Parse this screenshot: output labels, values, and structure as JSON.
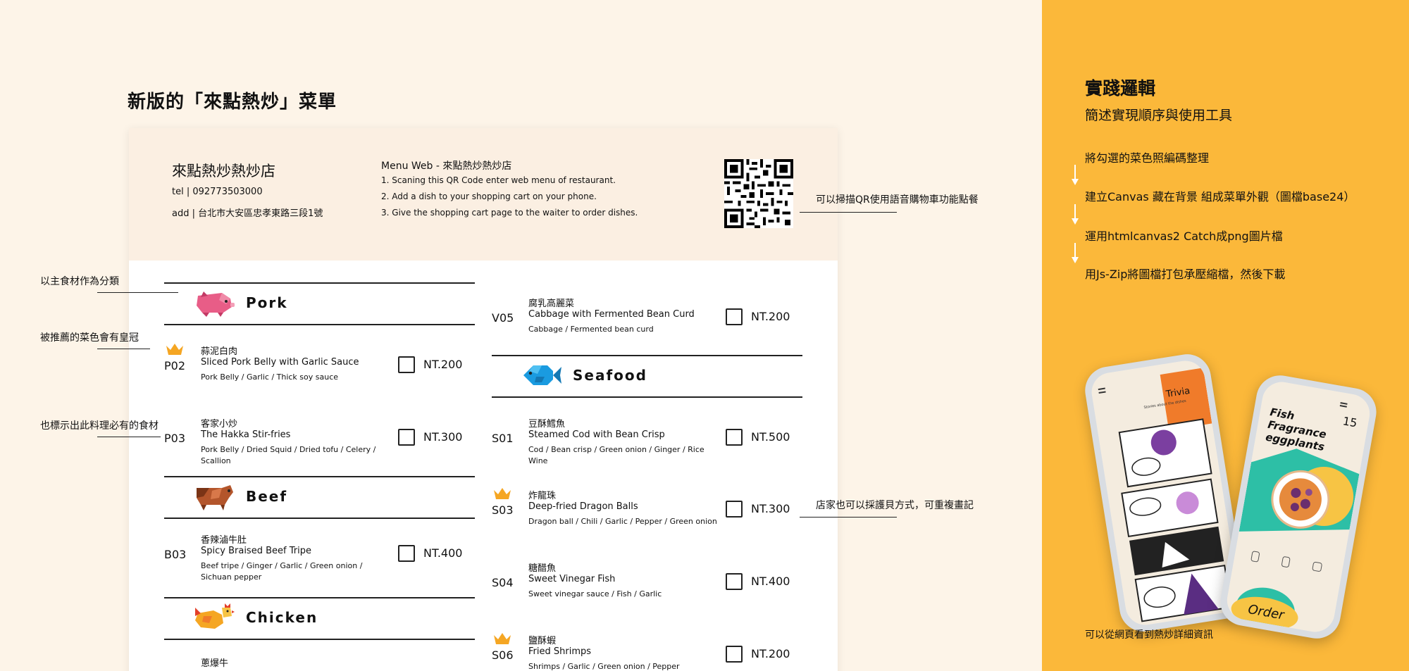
{
  "page_title": "新版的「來點熱炒」菜單",
  "header": {
    "shop_name": "來點熱炒熱炒店",
    "tel": "tel | 092773503000",
    "addr": "add | 台北市大安區忠孝東路三段1號",
    "web_title": "Menu Web - 來點熱炒熱炒店",
    "steps": [
      "1.  Scaning this QR Code enter web menu of restaurant.",
      "2.  Add a dish to your shopping cart on your phone.",
      "3.  Give the shopping cart page to the waiter to order dishes."
    ]
  },
  "categories": {
    "pork": "Pork",
    "beef": "Beef",
    "chicken": "Chicken",
    "seafood": "Seafood"
  },
  "items": {
    "p02": {
      "code": "P02",
      "zh": "蒜泥白肉",
      "en": "Sliced Pork Belly with Garlic Sauce",
      "ing": "Pork Belly / Garlic / Thick soy sauce",
      "price": "NT.200"
    },
    "p03": {
      "code": "P03",
      "zh": "客家小炒",
      "en": "The Hakka Stir-fries",
      "ing": "Pork Belly / Dried Squid / Dried tofu / Celery / Scallion",
      "price": "NT.300"
    },
    "b03": {
      "code": "B03",
      "zh": "香辣滷牛肚",
      "en": "Spicy Braised Beef Tripe",
      "ing": "Beef tripe / Ginger / Garlic / Green onion / Sichuan pepper",
      "price": "NT.400"
    },
    "c01": {
      "zh": "蔥爆牛"
    },
    "v05": {
      "code": "V05",
      "zh": "腐乳高麗菜",
      "en": "Cabbage with Fermented Bean Curd",
      "ing": "Cabbage / Fermented bean curd",
      "price": "NT.200"
    },
    "s01": {
      "code": "S01",
      "zh": "豆酥鱈魚",
      "en": "Steamed Cod with Bean Crisp",
      "ing": "Cod / Bean crisp / Green onion / Ginger / Rice Wine",
      "price": "NT.500"
    },
    "s03": {
      "code": "S03",
      "zh": "炸龍珠",
      "en": "Deep-fried Dragon Balls",
      "ing": "Dragon ball / Chili / Garlic / Pepper / Green onion",
      "price": "NT.300"
    },
    "s04": {
      "code": "S04",
      "zh": "糖醋魚",
      "en": "Sweet Vinegar Fish",
      "ing": "Sweet vinegar sauce / Fish / Garlic",
      "price": "NT.400"
    },
    "s06": {
      "code": "S06",
      "zh": "鹽酥蝦",
      "en": "Fried Shrimps",
      "ing": "Shrimps / Garlic / Green onion / Pepper",
      "price": "NT.200"
    }
  },
  "annotations": {
    "category": "以主食材作為分類",
    "crown": "被推薦的菜色會有皇冠",
    "ingredients": "也標示出此料理必有的食材",
    "qr": "可以掃描QR使用語音購物車功能點餐",
    "reuse": "店家也可以採護貝方式，可重複畫記"
  },
  "panel": {
    "title": "實踐邏輯",
    "subtitle": "簡述實現順序與使用工具",
    "steps": [
      "將勾選的菜色照編碼整理",
      "建立Canvas 藏在背景 組成菜單外觀（圖檔base24）",
      "運用htmlcanvas2 Catch成png圖片檔",
      "用Js-Zip將圖檔打包承壓縮檔，然後下載"
    ],
    "caption": "可以從網頁看到熱炒詳細資訊",
    "accent": "#fbb83a"
  },
  "phones": {
    "left": {
      "title": "Trivia",
      "subtitle": "Stories about the dishes"
    },
    "right": {
      "title": "Fish Fragrance eggplants",
      "number": "15",
      "order": "Order"
    }
  },
  "colors": {
    "background": "#fdf4e8",
    "header": "#fbefe2",
    "crown": "#f5a623"
  }
}
